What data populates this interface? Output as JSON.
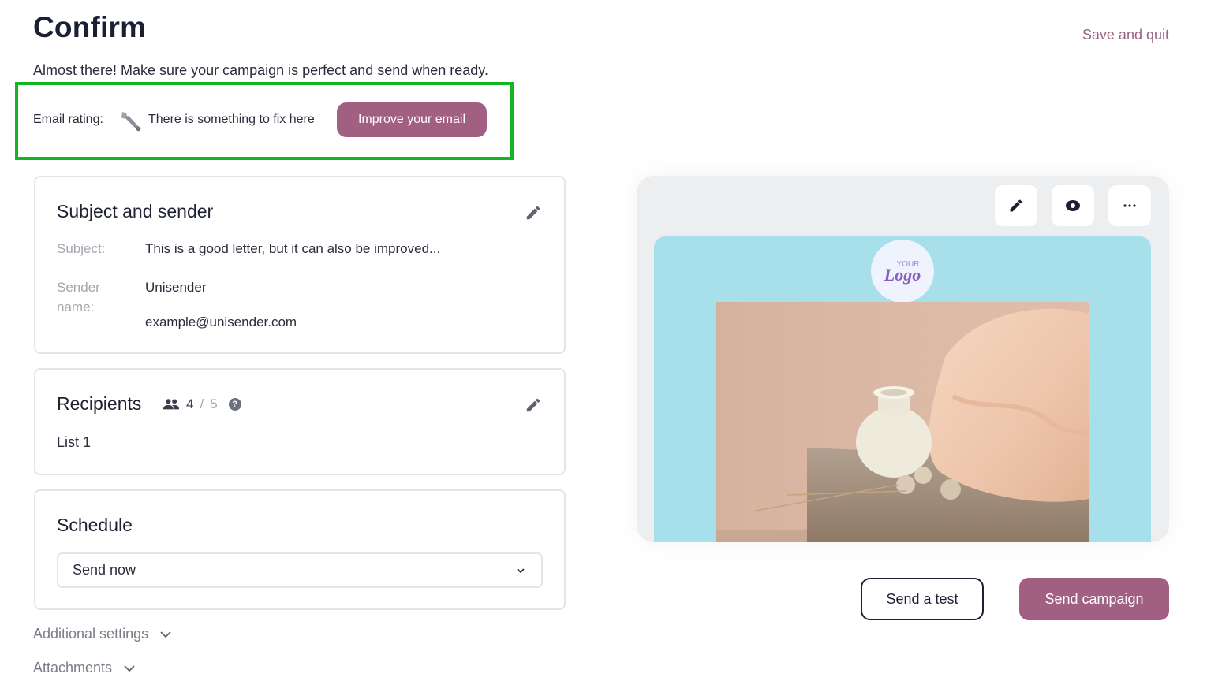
{
  "header": {
    "title": "Confirm",
    "subtitle": "Almost there! Make sure your campaign is perfect and send when ready.",
    "save_and_quit": "Save and quit"
  },
  "rating": {
    "label": "Email rating:",
    "status_icon": "wrench-icon",
    "status": "There is something to fix here",
    "improve_button": "Improve your email",
    "highlight_color": "#12b71f"
  },
  "subject_card": {
    "title": "Subject and sender",
    "subject_label": "Subject:",
    "subject_value": "This is a good letter, but it can also be improved...",
    "sender_label": "Sender name:",
    "sender_name": "Unisender",
    "sender_email": "example@unisender.com"
  },
  "recipients_card": {
    "title": "Recipients",
    "count": "4",
    "separator": "/",
    "total": "5",
    "help": "?",
    "list_name": "List 1"
  },
  "schedule_card": {
    "title": "Schedule",
    "selected": "Send now"
  },
  "expanders": {
    "additional_settings": "Additional settings",
    "attachments": "Attachments"
  },
  "preview": {
    "tools": [
      "edit-icon",
      "eye-icon",
      "more-icon"
    ],
    "logo_small": "YOUR",
    "logo_big": "Logo",
    "canvas_color": "#a7e0ea"
  },
  "actions": {
    "send_test": "Send a test",
    "send_campaign": "Send campaign"
  },
  "colors": {
    "accent": "#a16082",
    "dark": "#1b1f35"
  }
}
